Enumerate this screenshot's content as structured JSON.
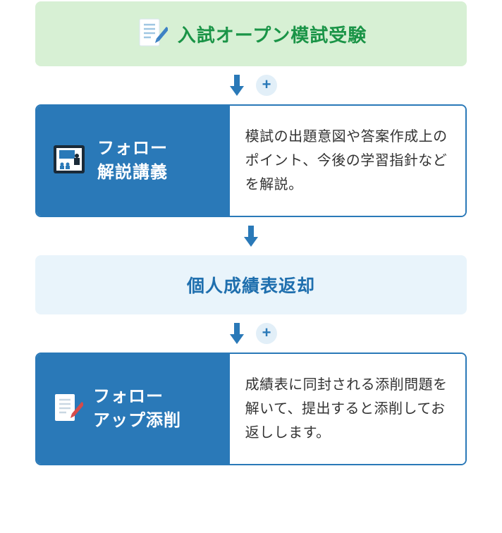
{
  "colors": {
    "green_bg": "#d7f0d4",
    "green_text": "#1a9447",
    "blue_primary": "#2a79b8",
    "blue_light_bg": "#e9f4fb",
    "plus_bg": "#e2eff8",
    "body_text": "#333333"
  },
  "step1": {
    "title": "入試オープン模試受験",
    "icon": "document-pencil-icon"
  },
  "arrow1": {
    "has_plus": true
  },
  "step2": {
    "title_line1": "フォロー",
    "title_line2": "解説講義",
    "icon": "tablet-lecture-icon",
    "description": "模試の出題意図や答案作成上のポイント、今後の学習指針などを解説。"
  },
  "arrow2": {
    "has_plus": false
  },
  "step3": {
    "title": "個人成績表返却"
  },
  "arrow3": {
    "has_plus": true
  },
  "step4": {
    "title_line1": "フォロー",
    "title_line2": "アップ添削",
    "icon": "document-red-pencil-icon",
    "description": "成績表に同封される添削問題を解いて、提出すると添削してお返しします。"
  }
}
